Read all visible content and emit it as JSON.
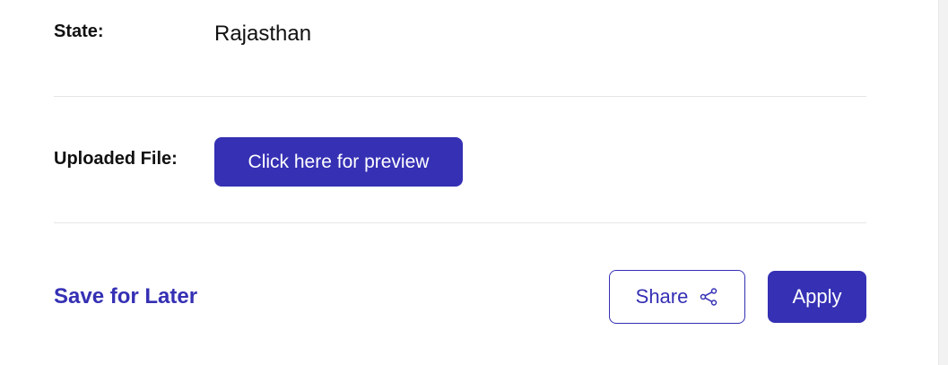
{
  "details": {
    "state_label": "State:",
    "state_value": "Rajasthan",
    "uploaded_file_label": "Uploaded File:",
    "preview_button_label": "Click here for preview"
  },
  "actions": {
    "save_for_later_label": "Save for Later",
    "share_label": "Share",
    "share_icon": "share-icon",
    "apply_label": "Apply"
  },
  "colors": {
    "accent": "#3530b4",
    "divider": "#e5e5e5",
    "text": "#111111",
    "background": "#ffffff"
  }
}
